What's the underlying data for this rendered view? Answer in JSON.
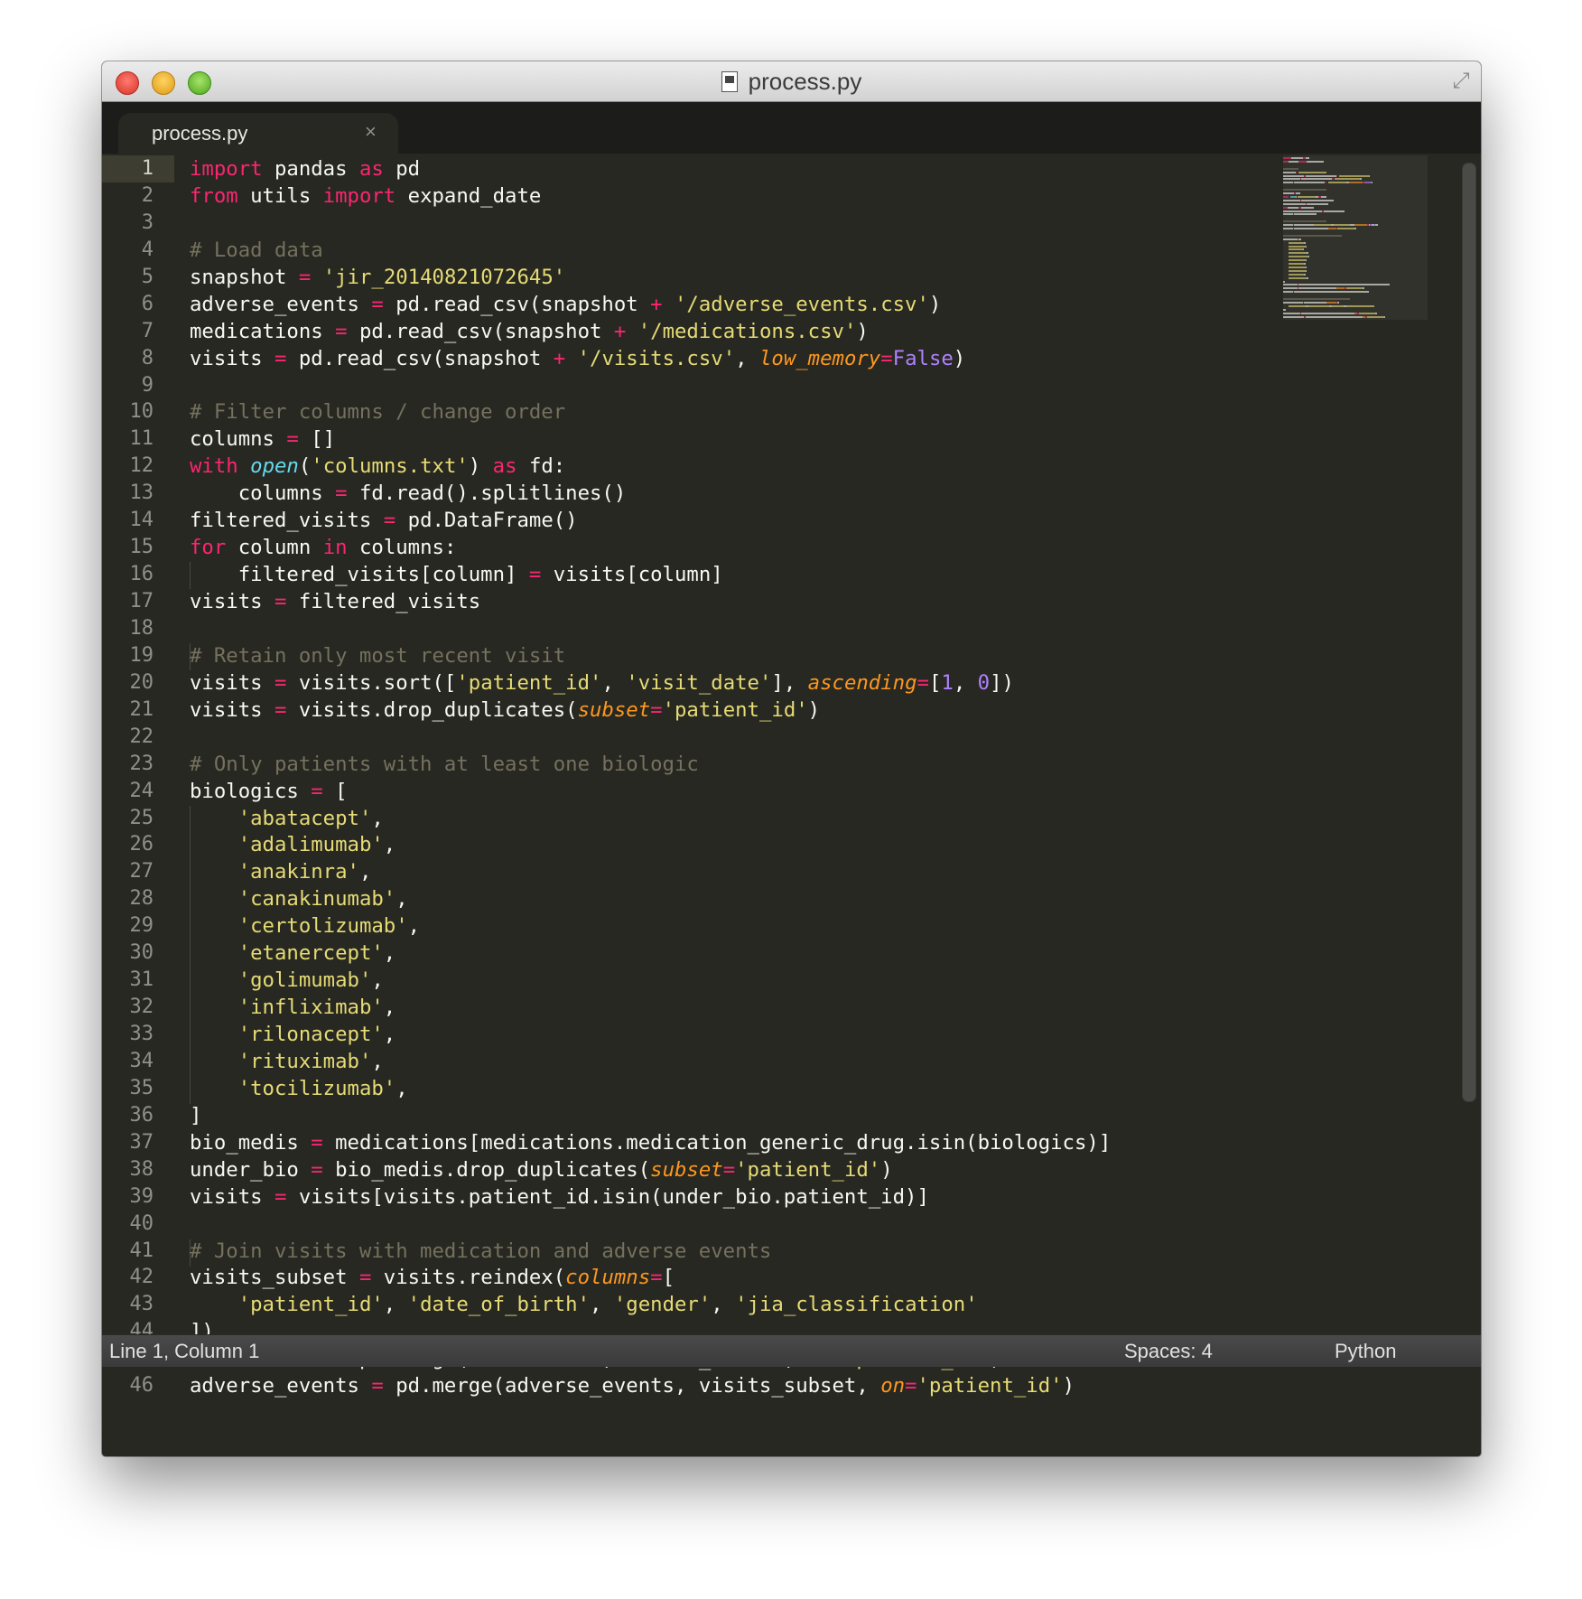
{
  "window": {
    "title": "process.py"
  },
  "tab": {
    "label": "process.py",
    "close_glyph": "×"
  },
  "status": {
    "position": "Line 1, Column 1",
    "spaces": "Spaces: 4",
    "syntax": "Python"
  },
  "icons": {
    "close": "close-icon",
    "fullscreen": "fullscreen-icon",
    "file": "python-file-icon"
  },
  "colors": {
    "background": "#272822",
    "keyword": "#f92672",
    "string": "#e6db74",
    "comment": "#75715e",
    "number": "#ae81ff",
    "param": "#fd971f",
    "builtin": "#66d9ef",
    "text": "#f8f8f2"
  },
  "editor": {
    "lines": [
      [
        [
          "k",
          "import"
        ],
        [
          "t",
          " pandas "
        ],
        [
          "k",
          "as"
        ],
        [
          "t",
          " pd"
        ]
      ],
      [
        [
          "k",
          "from"
        ],
        [
          "t",
          " utils "
        ],
        [
          "k",
          "import"
        ],
        [
          "t",
          " expand_date"
        ]
      ],
      [],
      [
        [
          "c",
          "# Load data"
        ]
      ],
      [
        [
          "t",
          "snapshot "
        ],
        [
          "k",
          "="
        ],
        [
          "t",
          " "
        ],
        [
          "s",
          "'jir_20140821072645'"
        ]
      ],
      [
        [
          "t",
          "adverse_events "
        ],
        [
          "k",
          "="
        ],
        [
          "t",
          " pd.read_csv(snapshot "
        ],
        [
          "k",
          "+"
        ],
        [
          "t",
          " "
        ],
        [
          "s",
          "'/adverse_events.csv'"
        ],
        [
          "t",
          ")"
        ]
      ],
      [
        [
          "t",
          "medications "
        ],
        [
          "k",
          "="
        ],
        [
          "t",
          " pd.read_csv(snapshot "
        ],
        [
          "k",
          "+"
        ],
        [
          "t",
          " "
        ],
        [
          "s",
          "'/medications.csv'"
        ],
        [
          "t",
          ")"
        ]
      ],
      [
        [
          "t",
          "visits "
        ],
        [
          "k",
          "="
        ],
        [
          "t",
          " pd.read_csv(snapshot "
        ],
        [
          "k",
          "+"
        ],
        [
          "t",
          " "
        ],
        [
          "s",
          "'/visits.csv'"
        ],
        [
          "t",
          ", "
        ],
        [
          "p",
          "low_memory"
        ],
        [
          "k",
          "="
        ],
        [
          "n",
          "False"
        ],
        [
          "t",
          ")"
        ]
      ],
      [],
      [
        [
          "c",
          "# Filter columns / change order"
        ]
      ],
      [
        [
          "t",
          "columns "
        ],
        [
          "k",
          "="
        ],
        [
          "t",
          " []"
        ]
      ],
      [
        [
          "k",
          "with"
        ],
        [
          "t",
          " "
        ],
        [
          "b",
          "open"
        ],
        [
          "t",
          "("
        ],
        [
          "s",
          "'columns.txt'"
        ],
        [
          "t",
          ") "
        ],
        [
          "k",
          "as"
        ],
        [
          "t",
          " fd:"
        ]
      ],
      [
        [
          "t",
          "    columns "
        ],
        [
          "k",
          "="
        ],
        [
          "t",
          " fd.read().splitlines()"
        ]
      ],
      [
        [
          "t",
          "filtered_visits "
        ],
        [
          "k",
          "="
        ],
        [
          "t",
          " pd.DataFrame()"
        ]
      ],
      [
        [
          "k",
          "for"
        ],
        [
          "t",
          " column "
        ],
        [
          "k",
          "in"
        ],
        [
          "t",
          " columns:"
        ]
      ],
      [
        [
          "t",
          "    filtered_visits[column] "
        ],
        [
          "k",
          "="
        ],
        [
          "t",
          " visits[column]"
        ]
      ],
      [
        [
          "t",
          "visits "
        ],
        [
          "k",
          "="
        ],
        [
          "t",
          " filtered_visits"
        ]
      ],
      [],
      [
        [
          "c",
          "# Retain only most recent visit"
        ]
      ],
      [
        [
          "t",
          "visits "
        ],
        [
          "k",
          "="
        ],
        [
          "t",
          " visits.sort(["
        ],
        [
          "s",
          "'patient_id'"
        ],
        [
          "t",
          ", "
        ],
        [
          "s",
          "'visit_date'"
        ],
        [
          "t",
          "], "
        ],
        [
          "p",
          "ascending"
        ],
        [
          "k",
          "="
        ],
        [
          "t",
          "["
        ],
        [
          "n",
          "1"
        ],
        [
          "t",
          ", "
        ],
        [
          "n",
          "0"
        ],
        [
          "t",
          "])"
        ]
      ],
      [
        [
          "t",
          "visits "
        ],
        [
          "k",
          "="
        ],
        [
          "t",
          " visits.drop_duplicates("
        ],
        [
          "p",
          "subset"
        ],
        [
          "k",
          "="
        ],
        [
          "s",
          "'patient_id'"
        ],
        [
          "t",
          ")"
        ]
      ],
      [],
      [
        [
          "c",
          "# Only patients with at least one biologic"
        ]
      ],
      [
        [
          "t",
          "biologics "
        ],
        [
          "k",
          "="
        ],
        [
          "t",
          " ["
        ]
      ],
      [
        [
          "t",
          "    "
        ],
        [
          "s",
          "'abatacept'"
        ],
        [
          "t",
          ","
        ]
      ],
      [
        [
          "t",
          "    "
        ],
        [
          "s",
          "'adalimumab'"
        ],
        [
          "t",
          ","
        ]
      ],
      [
        [
          "t",
          "    "
        ],
        [
          "s",
          "'anakinra'"
        ],
        [
          "t",
          ","
        ]
      ],
      [
        [
          "t",
          "    "
        ],
        [
          "s",
          "'canakinumab'"
        ],
        [
          "t",
          ","
        ]
      ],
      [
        [
          "t",
          "    "
        ],
        [
          "s",
          "'certolizumab'"
        ],
        [
          "t",
          ","
        ]
      ],
      [
        [
          "t",
          "    "
        ],
        [
          "s",
          "'etanercept'"
        ],
        [
          "t",
          ","
        ]
      ],
      [
        [
          "t",
          "    "
        ],
        [
          "s",
          "'golimumab'"
        ],
        [
          "t",
          ","
        ]
      ],
      [
        [
          "t",
          "    "
        ],
        [
          "s",
          "'infliximab'"
        ],
        [
          "t",
          ","
        ]
      ],
      [
        [
          "t",
          "    "
        ],
        [
          "s",
          "'rilonacept'"
        ],
        [
          "t",
          ","
        ]
      ],
      [
        [
          "t",
          "    "
        ],
        [
          "s",
          "'rituximab'"
        ],
        [
          "t",
          ","
        ]
      ],
      [
        [
          "t",
          "    "
        ],
        [
          "s",
          "'tocilizumab'"
        ],
        [
          "t",
          ","
        ]
      ],
      [
        [
          "t",
          "]"
        ]
      ],
      [
        [
          "t",
          "bio_medis "
        ],
        [
          "k",
          "="
        ],
        [
          "t",
          " medications[medications.medication_generic_drug.isin(biologics)]"
        ]
      ],
      [
        [
          "t",
          "under_bio "
        ],
        [
          "k",
          "="
        ],
        [
          "t",
          " bio_medis.drop_duplicates("
        ],
        [
          "p",
          "subset"
        ],
        [
          "k",
          "="
        ],
        [
          "s",
          "'patient_id'"
        ],
        [
          "t",
          ")"
        ]
      ],
      [
        [
          "t",
          "visits "
        ],
        [
          "k",
          "="
        ],
        [
          "t",
          " visits[visits.patient_id.isin(under_bio.patient_id)]"
        ]
      ],
      [],
      [
        [
          "c",
          "# Join visits with medication and adverse events"
        ]
      ],
      [
        [
          "t",
          "visits_subset "
        ],
        [
          "k",
          "="
        ],
        [
          "t",
          " visits.reindex("
        ],
        [
          "p",
          "columns"
        ],
        [
          "k",
          "="
        ],
        [
          "t",
          "["
        ]
      ],
      [
        [
          "t",
          "    "
        ],
        [
          "s",
          "'patient_id'"
        ],
        [
          "t",
          ", "
        ],
        [
          "s",
          "'date_of_birth'"
        ],
        [
          "t",
          ", "
        ],
        [
          "s",
          "'gender'"
        ],
        [
          "t",
          ", "
        ],
        [
          "s",
          "'jia_classification'"
        ]
      ],
      [
        [
          "t",
          "])"
        ]
      ],
      [
        [
          "t",
          "medications "
        ],
        [
          "k",
          "="
        ],
        [
          "t",
          " pd.merge(medications, visits_subset, "
        ],
        [
          "p",
          "on"
        ],
        [
          "k",
          "="
        ],
        [
          "s",
          "'patient_id'"
        ],
        [
          "t",
          ")"
        ]
      ],
      [
        [
          "t",
          "adverse_events "
        ],
        [
          "k",
          "="
        ],
        [
          "t",
          " pd.merge(adverse_events, visits_subset, "
        ],
        [
          "p",
          "on"
        ],
        [
          "k",
          "="
        ],
        [
          "s",
          "'patient_id'"
        ],
        [
          "t",
          ")"
        ]
      ]
    ]
  }
}
